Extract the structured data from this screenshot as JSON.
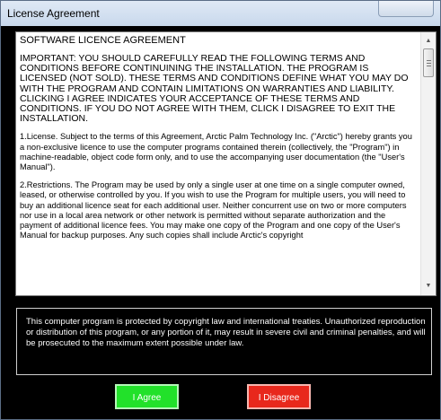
{
  "window": {
    "title": "License Agreement"
  },
  "license": {
    "heading": "SOFTWARE LICENCE AGREEMENT",
    "paragraphs": [
      "IMPORTANT: YOU SHOULD CAREFULLY READ THE FOLLOWING TERMS AND CONDITIONS BEFORE CONTINUINING THE INSTALLATION. THE PROGRAM IS LICENSED (NOT SOLD). THESE TERMS AND CONDITIONS DEFINE WHAT YOU MAY DO WITH THE PROGRAM AND CONTAIN LIMITATIONS ON WARRANTIES AND LIABILITY.  CLICKING I AGREE INDICATES YOUR ACCEPTANCE OF THESE TERMS AND CONDITIONS. IF YOU DO NOT AGREE WITH THEM, CLICK I DISAGREE TO EXIT THE INSTALLATION.",
      "1.License.  Subject to the terms of this Agreement, Arctic Palm Technology Inc. (\"Arctic\") hereby grants you a non-exclusive licence to use the computer programs contained therein (collectively, the \"Program\") in machine-readable, object code form only, and to use the accompanying user documentation (the \"User's Manual\").",
      "2.Restrictions.  The Program may be used by only a single user at one time on a single computer owned, leased, or otherwise controlled by you.  If you wish to use the Program for multiple users, you will need to buy an additional licence seat for each additional user.  Neither concurrent use on two or more computers nor use in a local area network or other network is permitted without separate authorization and the payment of additional licence fees.  You may make one copy of the Program and one copy of the User's Manual for backup purposes. Any such copies shall include Arctic's copyright"
    ]
  },
  "notice": {
    "text": "This computer program is protected by copyright law and international treaties. Unauthorized reproduction or distribution of this program, or any portion of it, may result in severe civil and criminal penalties, and will be prosecuted to the maximum extent possible under law."
  },
  "buttons": {
    "agree": "I Agree",
    "disagree": "I Disagree"
  },
  "scroll": {
    "position": 0.0
  }
}
